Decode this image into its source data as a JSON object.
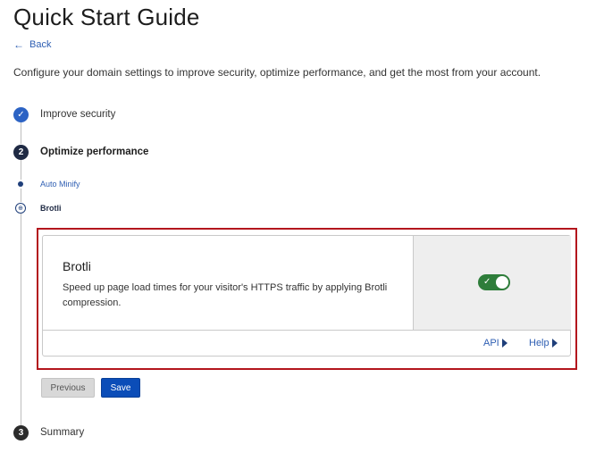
{
  "header": {
    "title": "Quick Start Guide",
    "back_label": "Back",
    "intro": "Configure your domain settings to improve security, optimize performance, and get the most from your account."
  },
  "steps": [
    {
      "number": "1",
      "label": "Improve security",
      "state": "completed",
      "icon": "checkmark-icon"
    },
    {
      "number": "2",
      "label": "Optimize performance",
      "state": "active"
    },
    {
      "number": "3",
      "label": "Summary",
      "state": "upcoming"
    }
  ],
  "substeps": [
    {
      "label": "Auto Minify",
      "state": "completed"
    },
    {
      "label": "Brotli",
      "state": "current"
    }
  ],
  "card": {
    "title": "Brotli",
    "description": "Speed up page load times for your visitor's HTTPS traffic by applying Brotli compression.",
    "toggle_on": true,
    "api_label": "API",
    "help_label": "Help"
  },
  "actions": {
    "previous_label": "Previous",
    "save_label": "Save"
  },
  "colors": {
    "accent": "#2c63c4",
    "toggle_on": "#2e7d3a",
    "highlight": "#b3161d",
    "save_button": "#0b4db8"
  }
}
